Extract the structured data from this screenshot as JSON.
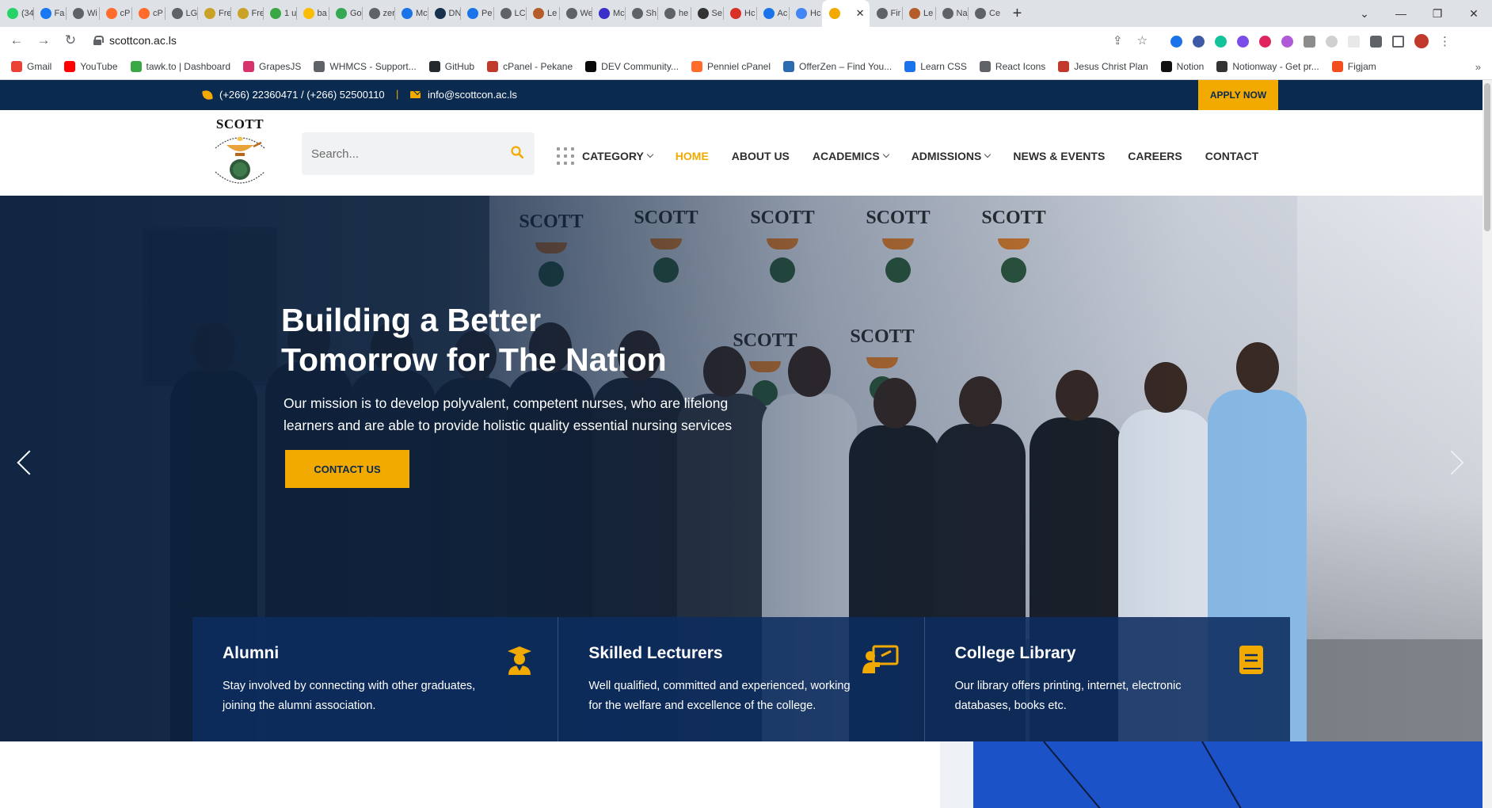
{
  "browser": {
    "tabs": [
      {
        "label": "(34",
        "color": "#25d366"
      },
      {
        "label": "Fa",
        "color": "#1877f2"
      },
      {
        "label": "Wi",
        "color": "#5f6368"
      },
      {
        "label": "cP",
        "color": "#ff6c2c"
      },
      {
        "label": "cP",
        "color": "#ff6c2c"
      },
      {
        "label": "LG",
        "color": "#5f6368"
      },
      {
        "label": "Fre",
        "color": "#c9a227"
      },
      {
        "label": "Fre",
        "color": "#c9a227"
      },
      {
        "label": "1 u",
        "color": "#3aa745"
      },
      {
        "label": "ba",
        "color": "#fbbc04"
      },
      {
        "label": "Go",
        "color": "#34a853"
      },
      {
        "label": "zer",
        "color": "#5f6368"
      },
      {
        "label": "Mc",
        "color": "#1a73e8"
      },
      {
        "label": "DN",
        "color": "#17324d"
      },
      {
        "label": "Pe",
        "color": "#1a73e8"
      },
      {
        "label": "LC",
        "color": "#5f6368"
      },
      {
        "label": "Le",
        "color": "#b55d2a"
      },
      {
        "label": "We",
        "color": "#5f6368"
      },
      {
        "label": "Mc",
        "color": "#3b2fc9"
      },
      {
        "label": "Sh",
        "color": "#5f6368"
      },
      {
        "label": "he",
        "color": "#5f6368"
      },
      {
        "label": "Se",
        "color": "#333333"
      },
      {
        "label": "Hc",
        "color": "#d93025"
      },
      {
        "label": "Ac",
        "color": "#1a73e8"
      },
      {
        "label": "Hc",
        "color": "#4285f4"
      },
      {
        "label": "",
        "color": "#f2a900",
        "active": true
      },
      {
        "label": "Fir",
        "color": "#5f6368"
      },
      {
        "label": "Le",
        "color": "#b55d2a"
      },
      {
        "label": "Na",
        "color": "#5f6368"
      },
      {
        "label": "Ce",
        "color": "#5f6368"
      }
    ],
    "url": "scottcon.ac.ls",
    "bookmarks": [
      {
        "label": "Gmail",
        "color": "#ea4335"
      },
      {
        "label": "YouTube",
        "color": "#ff0000"
      },
      {
        "label": "tawk.to | Dashboard",
        "color": "#3aa745"
      },
      {
        "label": "GrapesJS",
        "color": "#d6336c"
      },
      {
        "label": "WHMCS - Support...",
        "color": "#5f6368"
      },
      {
        "label": "GitHub",
        "color": "#24292e"
      },
      {
        "label": "cPanel - Pekane",
        "color": "#c0392b"
      },
      {
        "label": "DEV Community...",
        "color": "#0a0a0a"
      },
      {
        "label": "Penniel cPanel",
        "color": "#ff6c2c"
      },
      {
        "label": "OfferZen – Find You...",
        "color": "#2b6cb0"
      },
      {
        "label": "Learn CSS",
        "color": "#1a73e8"
      },
      {
        "label": "React Icons",
        "color": "#5f6368"
      },
      {
        "label": "Jesus Christ Plan",
        "color": "#c0392b"
      },
      {
        "label": "Notion",
        "color": "#111111"
      },
      {
        "label": "Notionway - Get pr...",
        "color": "#333333"
      },
      {
        "label": "Figjam",
        "color": "#f24e1e"
      }
    ]
  },
  "site": {
    "topbar": {
      "phone": "(+266) 22360471 / (+266) 52500110",
      "separator": "|",
      "email": "info@scottcon.ac.ls",
      "apply_label": "APPLY NOW"
    },
    "logo_word": "SCOTT",
    "search_placeholder": "Search...",
    "nav": {
      "category": "CATEGORY",
      "items": [
        {
          "label": "HOME",
          "active": true
        },
        {
          "label": "ABOUT US"
        },
        {
          "label": "ACADEMICS",
          "dropdown": true
        },
        {
          "label": "ADMISSIONS",
          "dropdown": true
        },
        {
          "label": "NEWS & EVENTS"
        },
        {
          "label": "CAREERS"
        },
        {
          "label": "CONTACT"
        }
      ]
    },
    "hero": {
      "title_line1": "Building a Better",
      "title_line2": "Tomorrow for The Nation",
      "text": "Our mission is to develop polyvalent, competent nurses, who are lifelong learners and are able to provide holistic quality essential nursing services",
      "cta_label": "CONTACT US",
      "banner_word": "SCOTT"
    },
    "features": [
      {
        "title": "Alumni",
        "text": "Stay involved by connecting with other graduates, joining the alumni association.",
        "icon": "graduate-icon"
      },
      {
        "title": "Skilled Lecturers",
        "text": "Well qualified, committed and experienced, working for the welfare and excellence of the college.",
        "icon": "lecturer-icon"
      },
      {
        "title": "College Library",
        "text": "Our library offers printing, internet, electronic databases, books etc.",
        "icon": "book-icon"
      }
    ],
    "accent_color": "#f2a900",
    "navy_color": "#0b2a4f"
  }
}
